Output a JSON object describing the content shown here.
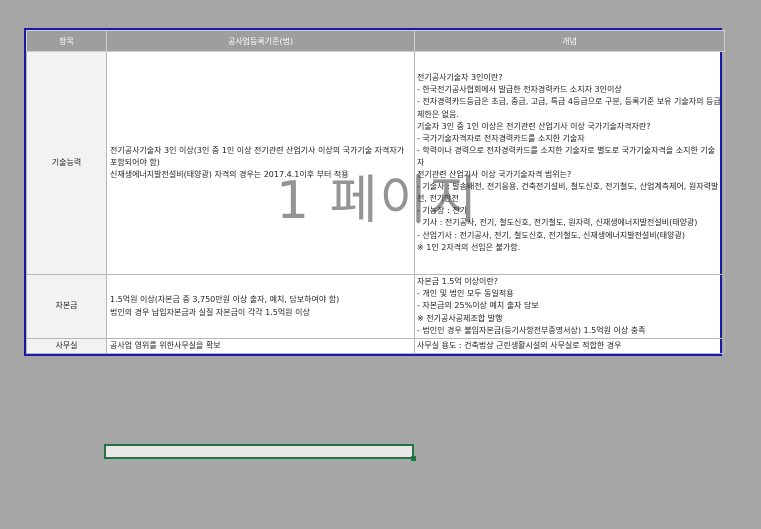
{
  "headers": [
    "항목",
    "공사업등록기준(법)",
    "개념"
  ],
  "rows": [
    {
      "category": "기술능력",
      "criteria": [
        "전기공사기술자 3인 이상(3인 중 1인 이상 전기관련 산업기사 이상의 국가기술 자격자가 포함되어야 함)",
        "신재생에너지발전설비(태양광) 자격의 경우는 2017.4.1이후 부터 적용"
      ],
      "description": [
        "전기공사기술자 3인이란?",
        "- 한국전기공사협회에서 발급한 전자경력카드 소지자 3인이상",
        "- 전자경력카드등급은 초급, 중급, 고급, 특급 4등급으로 구분, 등록기준 보유 기술자의 등급제한은 없음.",
        "기술자 3인 중 1인 이상은 전기관련 산업기사 이상 국가기술자격자란?",
        "- 국가기술자격자로 전자경력카드를 소지한 기술자",
        "- 학력이나 경력으로 전자경력카드를 소지한 기술자로 별도로 국가기술자격을 소지한 기술자",
        "전기관련 산업기사 이상 국가기술자격 범위는?",
        "- 기술사 : 발송배전, 전기응용, 건축전기설비, 철도신호, 전기철도, 산업계측제어, 원자력발전, 전기안전",
        "- 기능장 : 전기",
        "- 기사 : 전기공사, 전기, 철도신호, 전기철도, 원자력, 신재생에너지발전설비(태양광)",
        "- 산업기사 : 전기공사, 전기, 철도신호, 전기철도, 신재생에너지발전설비(태양광)",
        "※ 1인 2자격의 선임은 불가함."
      ]
    },
    {
      "category": "자본금",
      "criteria": [
        "1.5억원 이상(자본금 중 3,750만원 이상 출자, 예치, 담보하여야 함)",
        "법인의 경우 납입자본금과 실질 자본금이 각각 1.5억원 이상"
      ],
      "description": [
        "자본금 1.5억 이상이란?",
        "- 개인 및 법인 모두 동일적용",
        "- 자본금의 25%이상 예치 출자 담보",
        "※ 전기공사공제조합 발행",
        "- 법인인 경우 불입자본금(등기사항전부증명서상) 1.5억원 이상 충족"
      ]
    },
    {
      "category": "사무실",
      "criteria": [
        "공사업 영위를 위한사무실을 확보"
      ],
      "description": [
        "사무실 용도 : 건축법상 근린생활시설의 사무실로 적합한 경우"
      ]
    }
  ],
  "watermark": "1 페이지"
}
